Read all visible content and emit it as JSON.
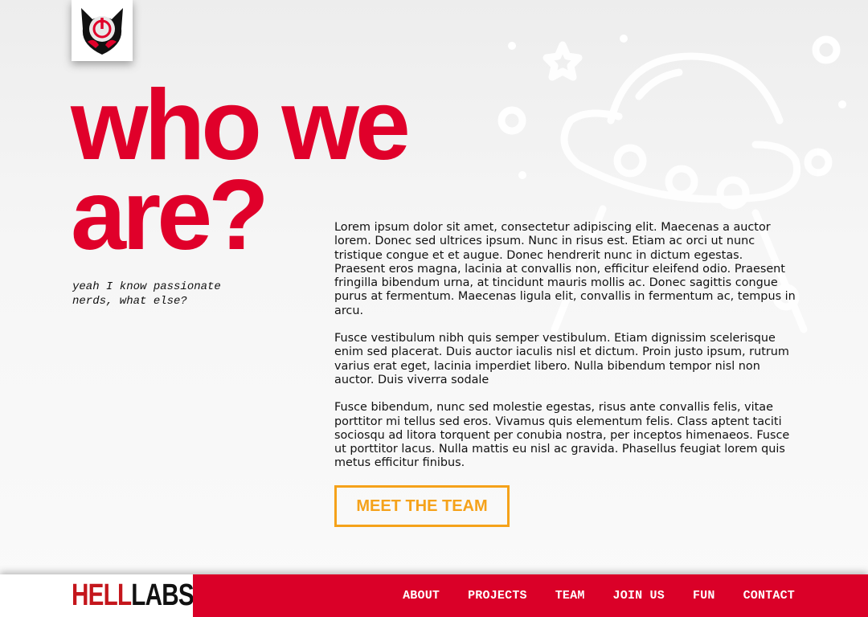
{
  "hero": {
    "title_line1": "who we",
    "title_line2": "are?",
    "subtitle_line1": "yeah I know passionate",
    "subtitle_line2": "nerds, what else?"
  },
  "content": {
    "paragraphs": [
      "Lorem ipsum dolor sit amet, consectetur adipiscing elit. Maecenas a auctor lorem. Donec sed ultrices ipsum. Nunc in risus est. Etiam ac orci ut nunc tristique congue et et augue. Donec hendrerit nunc in dictum egestas. Praesent eros magna, lacinia at convallis non, efficitur eleifend odio. Praesent fringilla bibendum urna, at tincidunt mauris mollis ac. Donec sagittis congue purus at fermentum. Maecenas ligula elit, convallis in fermentum ac, tempus in arcu.",
      "Fusce vestibulum nibh quis semper vestibulum. Etiam dignissim scelerisque enim sed placerat. Duis auctor iaculis nisl et dictum. Proin justo ipsum, rutrum varius erat eget, lacinia imperdiet libero. Nulla bibendum tempor nisl non auctor. Duis viverra sodale",
      "Fusce bibendum, nunc sed molestie egestas, risus ante convallis felis, vitae porttitor mi tellus sed eros. Vivamus quis elementum felis. Class aptent taciti sociosqu ad litora torquent per conubia nostra, per inceptos himenaeos. Fusce ut porttitor lacus. Nulla mattis eu nisl ac gravida. Phasellus feugiat lorem quis metus efficitur finibus."
    ],
    "cta_label": "MEET THE TEAM"
  },
  "footer": {
    "brand_part1": "HELL",
    "brand_part2": "LABS",
    "nav": [
      "ABOUT",
      "PROJECTS",
      "TEAM",
      "JOIN US",
      "FUN",
      "CONTACT"
    ]
  },
  "colors": {
    "accent_red": "#e0002a",
    "nav_red": "#da0028",
    "cta_orange": "#f5a21a"
  },
  "icons": {
    "logo": "devil-power-logo-icon",
    "background": "ufo-illustration-icon"
  }
}
